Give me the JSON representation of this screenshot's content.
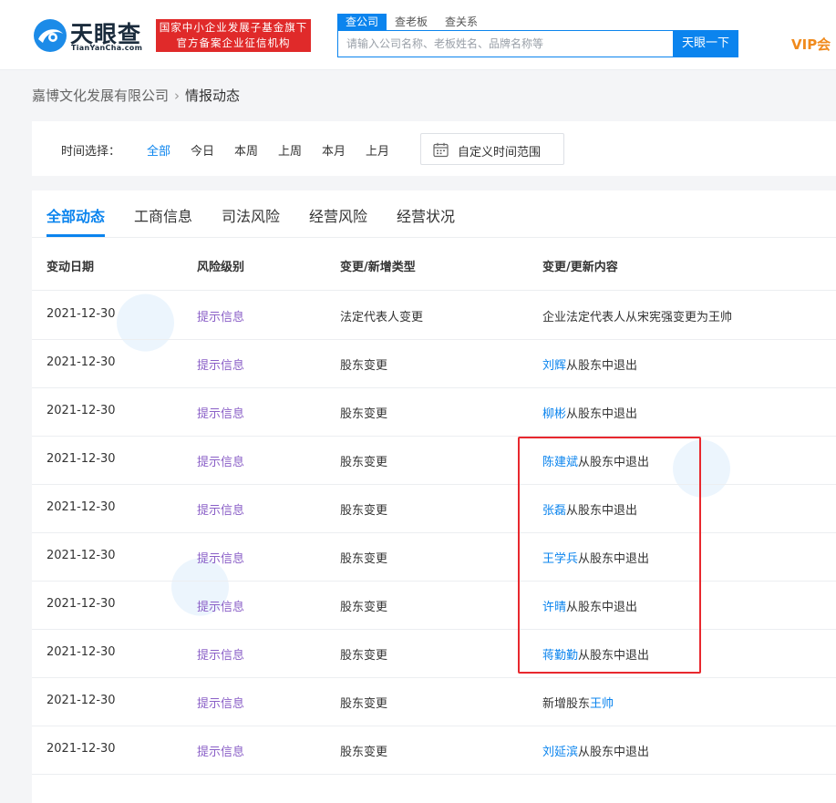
{
  "header": {
    "logo_name": "天眼查",
    "logo_sub": "TianYanCha.com",
    "badge_line1": "国家中小企业发展子基金旗下",
    "badge_line2": "官方备案企业征信机构",
    "search_tabs": [
      "查公司",
      "查老板",
      "查关系"
    ],
    "search_placeholder": "请输入公司名称、老板姓名、品牌名称等",
    "search_button": "天眼一下",
    "vip": "VIP会"
  },
  "breadcrumb": {
    "company": "嘉博文化发展有限公司",
    "separator": "›",
    "current": "情报动态"
  },
  "time_filter": {
    "label": "时间选择：",
    "options": [
      "全部",
      "今日",
      "本周",
      "上周",
      "本月",
      "上月"
    ],
    "selected": "全部",
    "custom_range": "自定义时间范围"
  },
  "tabs": [
    "全部动态",
    "工商信息",
    "司法风险",
    "经营风险",
    "经营状况"
  ],
  "table": {
    "headers": [
      "变动日期",
      "风险级别",
      "变更/新增类型",
      "变更/更新内容"
    ],
    "rows": [
      {
        "date": "2021-12-30",
        "risk": "提示信息",
        "type": "法定代表人变更",
        "pre": "",
        "link": "",
        "text": "企业法定代表人从宋宪强变更为王帅"
      },
      {
        "date": "2021-12-30",
        "risk": "提示信息",
        "type": "股东变更",
        "pre": "",
        "link": "刘辉",
        "text": "从股东中退出"
      },
      {
        "date": "2021-12-30",
        "risk": "提示信息",
        "type": "股东变更",
        "pre": "",
        "link": "柳彬",
        "text": "从股东中退出"
      },
      {
        "date": "2021-12-30",
        "risk": "提示信息",
        "type": "股东变更",
        "pre": "",
        "link": "陈建斌",
        "text": "从股东中退出"
      },
      {
        "date": "2021-12-30",
        "risk": "提示信息",
        "type": "股东变更",
        "pre": "",
        "link": "张磊",
        "text": "从股东中退出"
      },
      {
        "date": "2021-12-30",
        "risk": "提示信息",
        "type": "股东变更",
        "pre": "",
        "link": "王学兵",
        "text": "从股东中退出"
      },
      {
        "date": "2021-12-30",
        "risk": "提示信息",
        "type": "股东变更",
        "pre": "",
        "link": "许晴",
        "text": "从股东中退出"
      },
      {
        "date": "2021-12-30",
        "risk": "提示信息",
        "type": "股东变更",
        "pre": "",
        "link": "蒋勤勤",
        "text": "从股东中退出"
      },
      {
        "date": "2021-12-30",
        "risk": "提示信息",
        "type": "股东变更",
        "pre": "新增股东",
        "link": "王帅",
        "text": ""
      },
      {
        "date": "2021-12-30",
        "risk": "提示信息",
        "type": "股东变更",
        "pre": "",
        "link": "刘延滨",
        "text": "从股东中退出"
      }
    ]
  },
  "colors": {
    "accent": "#0b84ee",
    "risk_text": "#8a5fc7",
    "badge_red": "#e02a2a",
    "highlight_red": "#e8282e",
    "vip_orange": "#f08a1c"
  },
  "icons": [
    "tianyancha-logo-icon",
    "calendar-icon"
  ]
}
